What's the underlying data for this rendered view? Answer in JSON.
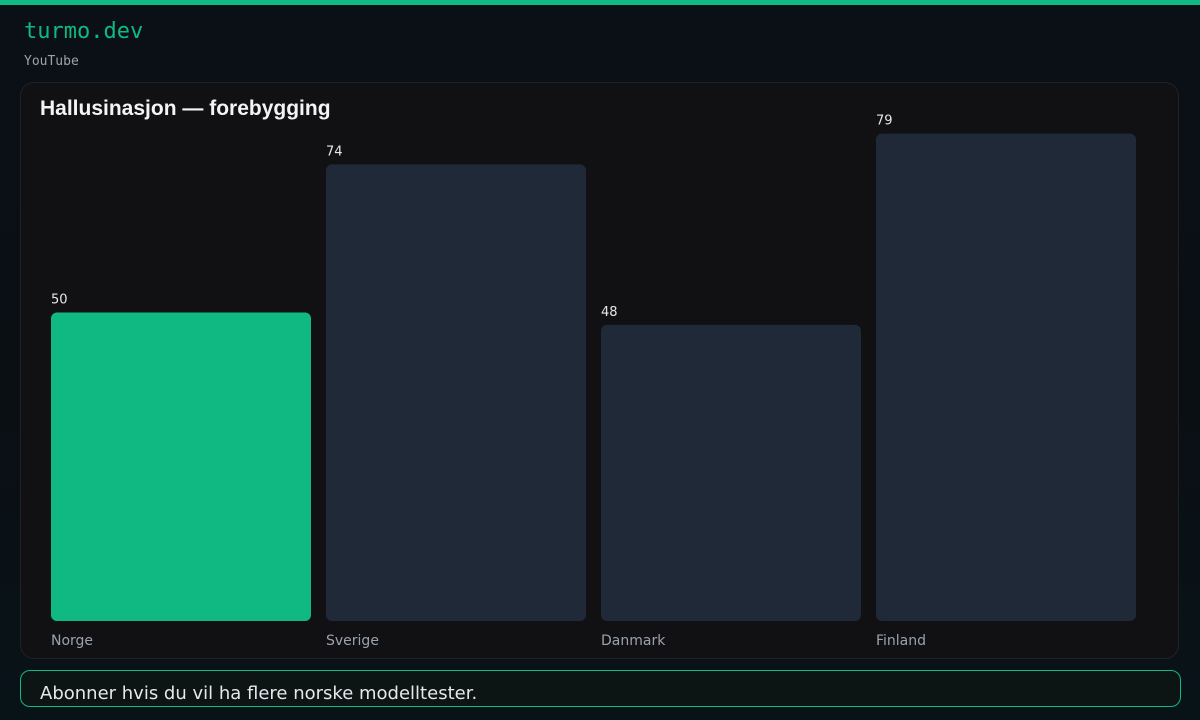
{
  "header": {
    "brand": "turmo.dev",
    "channel": "YouTube"
  },
  "colors": {
    "accent": "#10b981",
    "bar_default": "#1f2937",
    "card_bg": "#111114"
  },
  "chart_data": {
    "type": "bar",
    "title": "Hallusinasjon — forebygging",
    "categories": [
      "Norge",
      "Sverige",
      "Danmark",
      "Finland"
    ],
    "values": [
      50,
      74,
      48,
      79
    ],
    "highlight": "Norge",
    "ylim": [
      0,
      100
    ],
    "grid": false,
    "legend": "none"
  },
  "footer": {
    "text": "Abonner hvis du vil ha flere norske modelltester."
  }
}
